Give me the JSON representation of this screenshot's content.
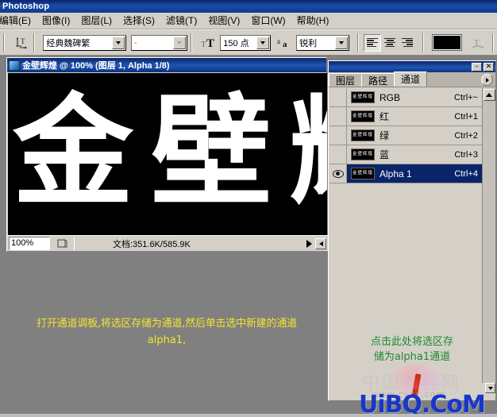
{
  "window": {
    "app_title": "Photoshop"
  },
  "menubar": {
    "items": [
      {
        "label": "编辑(E)",
        "name": "menu-edit"
      },
      {
        "label": "图像(I)",
        "name": "menu-image"
      },
      {
        "label": "图层(L)",
        "name": "menu-layer"
      },
      {
        "label": "选择(S)",
        "name": "menu-select"
      },
      {
        "label": "滤镜(T)",
        "name": "menu-filter"
      },
      {
        "label": "视图(V)",
        "name": "menu-view"
      },
      {
        "label": "窗口(W)",
        "name": "menu-window"
      },
      {
        "label": "帮助(H)",
        "name": "menu-help"
      }
    ]
  },
  "options_bar": {
    "tool_icon": "text-orientation-icon",
    "font_family": "经典魏碑繁",
    "font_style": "-",
    "size_icon": "font-size-icon",
    "font_size": "150 点",
    "antialias_icon": "anti-alias-icon",
    "antialias": "锐利",
    "align_left": "align-left-icon",
    "align_center": "align-center-icon",
    "align_right": "align-right-icon",
    "color_swatch": "#000000",
    "warp_icon": "warp-text-icon"
  },
  "document": {
    "title": "金壁辉煌 @ 100% (图层 1, Alpha 1/8)",
    "icon": "document-icon",
    "canvas_text": "金壁辉",
    "canvas_bg": "#000000",
    "canvas_fg": "#ffffff",
    "status": {
      "zoom": "100%",
      "preview_icon": "preview-icon",
      "info": "文档:351.6K/585.9K",
      "next_icon": "play-right-icon",
      "resize_icon": "resize-grip-icon"
    }
  },
  "palette": {
    "minimize_label": "–",
    "close_label": "✕",
    "menu_icon": "palette-menu-icon",
    "tabs": [
      {
        "label": "图层",
        "name": "tab-layers",
        "active": false
      },
      {
        "label": "路径",
        "name": "tab-paths",
        "active": false
      },
      {
        "label": "通道",
        "name": "tab-channels",
        "active": true
      }
    ],
    "thumb_text": "金壁辉煌",
    "channels": [
      {
        "name": "RGB",
        "shortcut": "Ctrl+~",
        "visible": false,
        "selected": false
      },
      {
        "name": "红",
        "shortcut": "Ctrl+1",
        "visible": false,
        "selected": false
      },
      {
        "name": "绿",
        "shortcut": "Ctrl+2",
        "visible": false,
        "selected": false
      },
      {
        "name": "蓝",
        "shortcut": "Ctrl+3",
        "visible": false,
        "selected": false
      },
      {
        "name": "Alpha 1",
        "shortcut": "Ctrl+4",
        "visible": true,
        "selected": true
      }
    ],
    "scroll_up_icon": "scroll-up-icon"
  },
  "annotations": {
    "yellow_line1": "打开通道调板,将选区存储为通道,然后单击选中新建的通道",
    "yellow_line2": "alpha1,",
    "yellow_color": "#f2e52b",
    "green_line1": "点击此处将选区存",
    "green_line2": "储为alpha1通道",
    "green_color": "#1f8a2e"
  },
  "watermark": {
    "cn_text": "中国教程网",
    "sub_text": "www.cycc.com",
    "main_text": "UiBQ.CoM",
    "main_color": "#1836c8"
  }
}
